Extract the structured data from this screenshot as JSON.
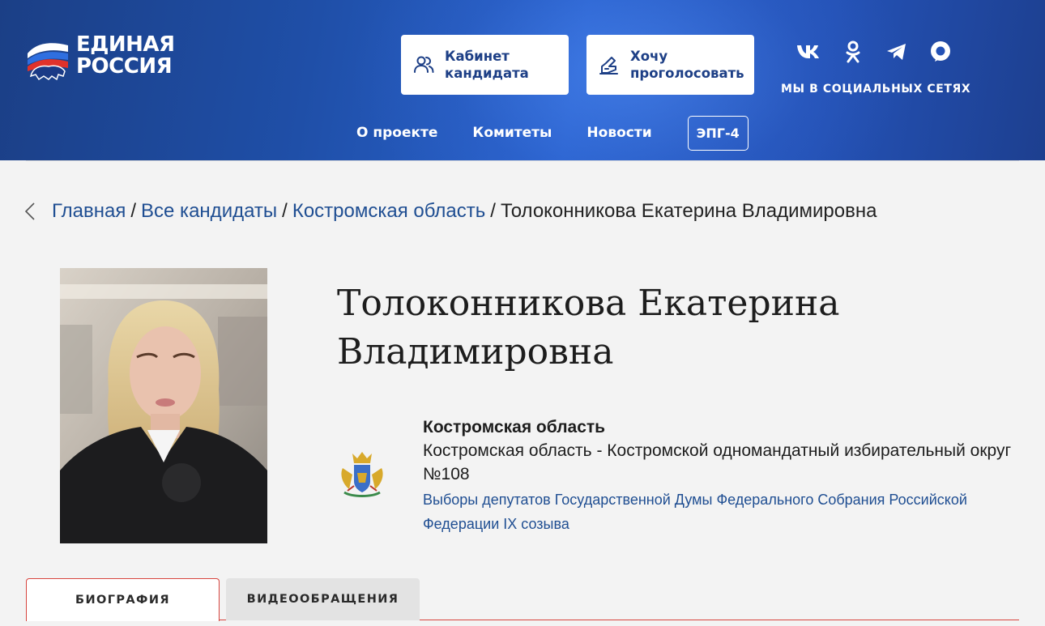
{
  "header": {
    "logo_line1": "ЕДИНАЯ",
    "logo_line2": "РОССИЯ",
    "cabinet_line1": "Кабинет",
    "cabinet_line2": "кандидата",
    "vote_line1": "Хочу",
    "vote_line2": "проголосовать",
    "socials_caption": "МЫ В СОЦИАЛЬНЫХ СЕТЯХ",
    "social_icons": [
      "vk-icon",
      "odnoklassniki-icon",
      "telegram-icon",
      "rutube-icon"
    ],
    "nav": [
      "О проекте",
      "Комитеты",
      "Новости"
    ],
    "nav_badge": "ЭПГ-4"
  },
  "breadcrumb": {
    "home": "Главная",
    "candidates": "Все кандидаты",
    "region": "Костромская область",
    "current": "Толоконникова Екатерина Владимировна",
    "separator": "/"
  },
  "candidate": {
    "name_line1": "Толоконникова Екатерина",
    "name_line2": "Владимировна",
    "region": "Костромская область",
    "district": "Костромская область - Костромской одномандатный избирательный округ №108",
    "election": "Выборы депутатов Государственной Думы Федерального Собрания Российской Федерации IX созыва"
  },
  "tabs": [
    {
      "label": "БИОГРАФИЯ",
      "active": true
    },
    {
      "label": "ВИДЕООБРАЩЕНИЯ",
      "active": false
    }
  ],
  "colors": {
    "brand_blue": "#1d3f86",
    "link_blue": "#1f4e92",
    "accent_red": "#d7443e",
    "page_bg": "#f3f3f3"
  }
}
